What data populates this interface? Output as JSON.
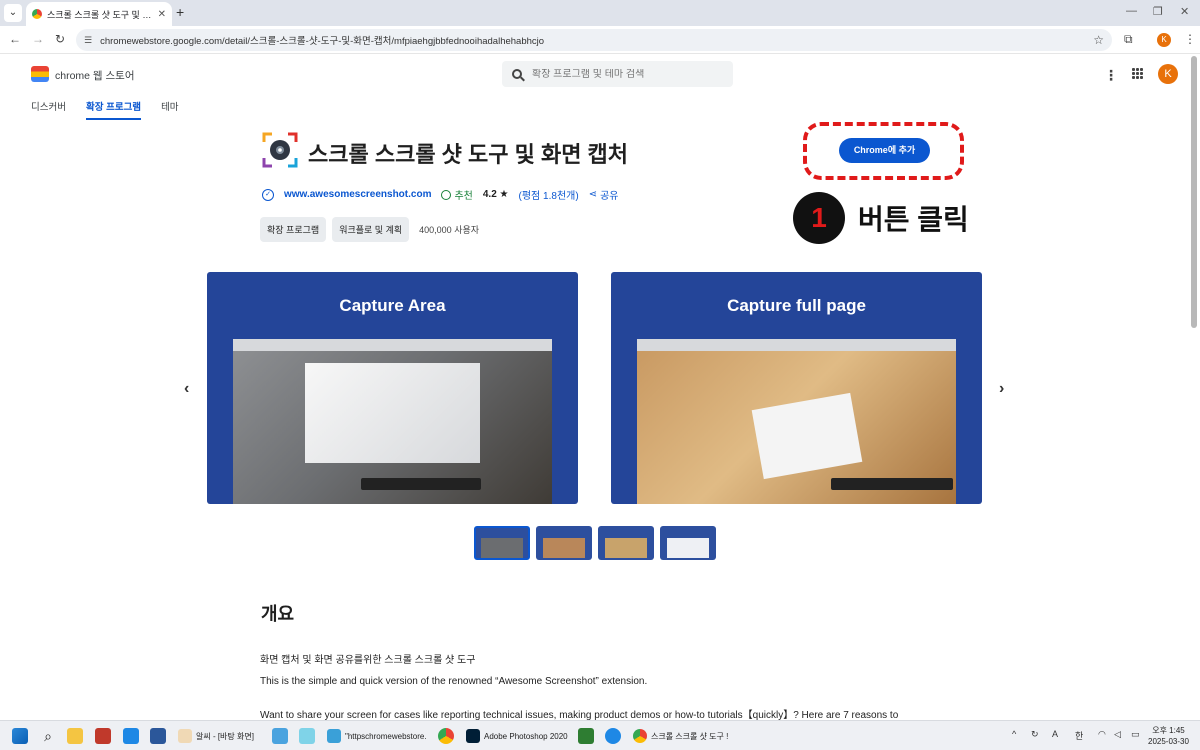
{
  "browser": {
    "tab_title": "스크롤 스크롤 샷 도구 및 화면",
    "url": "chromewebstore.google.com/detail/스크롤-스크롤-샷-도구-및-화면-캡처/mfpiaehgjbbfednooihadalhehabhcjo",
    "profile_initial": "K"
  },
  "store": {
    "name": "chrome 웹 스토어",
    "search_placeholder": "확장 프로그램 및 테마 검색",
    "avatar_initial": "K",
    "nav": [
      "디스커버",
      "확장 프로그램",
      "테마"
    ]
  },
  "extension": {
    "title": "스크롤 스크롤 샷 도구 및 화면 캡처",
    "website": "www.awesomescreenshot.com",
    "featured": "추천",
    "rating": "4.2 ★",
    "reviews": "(평점 1.8천개)",
    "share": "공유",
    "chips": [
      "확장 프로그램",
      "워크플로 및 계획"
    ],
    "users": "400,000 사용자",
    "add_button": "Chrome에 추가"
  },
  "annotation": {
    "step_number": "1",
    "step_text": "버튼 클릭",
    "highlight_color": "#e01a1a"
  },
  "carousel": {
    "slides": [
      "Capture Area",
      "Capture full page"
    ],
    "thumbnail_count": 4,
    "active_thumbnail": 1
  },
  "overview": {
    "title": "개요",
    "lines": [
      "화면 캡처 및 화면 공유를위한 스크롤 스크롤 샷 도구",
      "This is the simple and quick version of the renowned “Awesome Screenshot” extension.",
      "Want to share your screen for cases like reporting technical issues, making product demos or how-to tutorials【quickly】? Here are 7 reasons to"
    ]
  },
  "taskbar": {
    "items": [
      "알씨 - [바탕 화면]",
      "\"httpschromewebstore.",
      "Adobe Photoshop 2020",
      "스크롤 스크롤 샷 도구 !"
    ],
    "tray_lang": "한",
    "time": "오후 1:45",
    "date": "2025-03-30"
  },
  "colors": {
    "accent": "#0b57d0",
    "slide_bg": "#244599"
  }
}
